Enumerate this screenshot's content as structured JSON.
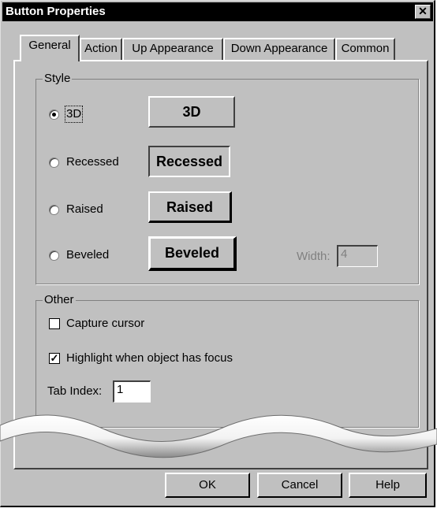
{
  "window": {
    "title": "Button Properties",
    "close_glyph": "✕"
  },
  "tabs": [
    {
      "label": "General",
      "active": true
    },
    {
      "label": "Action",
      "active": false
    },
    {
      "label": "Up Appearance",
      "active": false
    },
    {
      "label": "Down Appearance",
      "active": false
    },
    {
      "label": "Common",
      "active": false
    }
  ],
  "style_group": {
    "legend": "Style",
    "options": [
      {
        "label": "3D",
        "selected": true,
        "sample_label": "3D"
      },
      {
        "label": "Recessed",
        "selected": false,
        "sample_label": "Recessed"
      },
      {
        "label": "Raised",
        "selected": false,
        "sample_label": "Raised"
      },
      {
        "label": "Beveled",
        "selected": false,
        "sample_label": "Beveled"
      }
    ],
    "width_label": "Width:",
    "width_value": "4"
  },
  "other_group": {
    "legend": "Other",
    "capture_cursor": {
      "label": "Capture cursor",
      "checked": false
    },
    "highlight_focus": {
      "label": "Highlight when object has focus",
      "checked": true
    },
    "tab_index_label": "Tab Index:",
    "tab_index_value": "1"
  },
  "buttons": {
    "ok": "OK",
    "cancel": "Cancel",
    "help": "Help"
  },
  "check_glyph": "✓"
}
